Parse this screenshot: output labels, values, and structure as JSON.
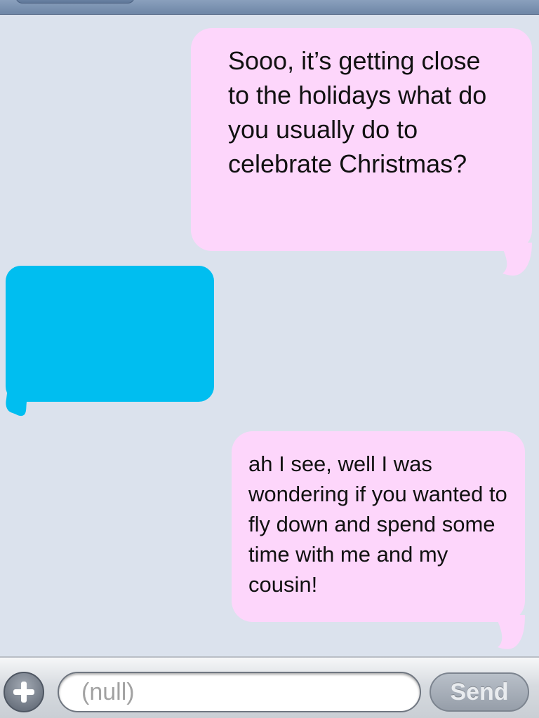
{
  "conversation": {
    "messages": [
      {
        "direction": "outgoing",
        "text": "Sooo, it’s getting close to the holidays what do you usually do to celebrate Christmas?"
      },
      {
        "direction": "incoming",
        "text": ""
      },
      {
        "direction": "outgoing",
        "text": "ah I see, well I was wondering if you wanted to fly down and spend some time with me and my cousin!"
      }
    ]
  },
  "composer": {
    "placeholder": "(null)",
    "send_label": "Send",
    "add_icon": "plus-icon"
  },
  "colors": {
    "outgoing_bubble": "#fdd6fb",
    "incoming_bubble": "#00bef0",
    "background": "#dbe2ed"
  }
}
